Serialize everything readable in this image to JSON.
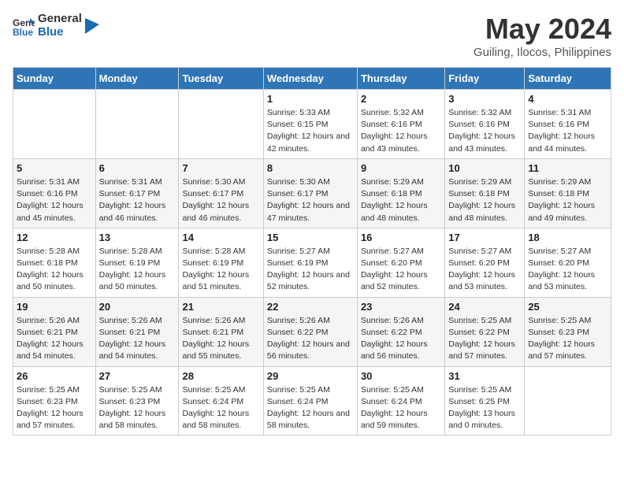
{
  "header": {
    "logo_line1": "General",
    "logo_line2": "Blue",
    "title": "May 2024",
    "subtitle": "Guiling, Ilocos, Philippines"
  },
  "days_of_week": [
    "Sunday",
    "Monday",
    "Tuesday",
    "Wednesday",
    "Thursday",
    "Friday",
    "Saturday"
  ],
  "weeks": [
    [
      {
        "day": "",
        "info": ""
      },
      {
        "day": "",
        "info": ""
      },
      {
        "day": "",
        "info": ""
      },
      {
        "day": "1",
        "sunrise": "Sunrise: 5:33 AM",
        "sunset": "Sunset: 6:15 PM",
        "daylight": "Daylight: 12 hours and 42 minutes."
      },
      {
        "day": "2",
        "sunrise": "Sunrise: 5:32 AM",
        "sunset": "Sunset: 6:16 PM",
        "daylight": "Daylight: 12 hours and 43 minutes."
      },
      {
        "day": "3",
        "sunrise": "Sunrise: 5:32 AM",
        "sunset": "Sunset: 6:16 PM",
        "daylight": "Daylight: 12 hours and 43 minutes."
      },
      {
        "day": "4",
        "sunrise": "Sunrise: 5:31 AM",
        "sunset": "Sunset: 6:16 PM",
        "daylight": "Daylight: 12 hours and 44 minutes."
      }
    ],
    [
      {
        "day": "5",
        "sunrise": "Sunrise: 5:31 AM",
        "sunset": "Sunset: 6:16 PM",
        "daylight": "Daylight: 12 hours and 45 minutes."
      },
      {
        "day": "6",
        "sunrise": "Sunrise: 5:31 AM",
        "sunset": "Sunset: 6:17 PM",
        "daylight": "Daylight: 12 hours and 46 minutes."
      },
      {
        "day": "7",
        "sunrise": "Sunrise: 5:30 AM",
        "sunset": "Sunset: 6:17 PM",
        "daylight": "Daylight: 12 hours and 46 minutes."
      },
      {
        "day": "8",
        "sunrise": "Sunrise: 5:30 AM",
        "sunset": "Sunset: 6:17 PM",
        "daylight": "Daylight: 12 hours and 47 minutes."
      },
      {
        "day": "9",
        "sunrise": "Sunrise: 5:29 AM",
        "sunset": "Sunset: 6:18 PM",
        "daylight": "Daylight: 12 hours and 48 minutes."
      },
      {
        "day": "10",
        "sunrise": "Sunrise: 5:29 AM",
        "sunset": "Sunset: 6:18 PM",
        "daylight": "Daylight: 12 hours and 48 minutes."
      },
      {
        "day": "11",
        "sunrise": "Sunrise: 5:29 AM",
        "sunset": "Sunset: 6:18 PM",
        "daylight": "Daylight: 12 hours and 49 minutes."
      }
    ],
    [
      {
        "day": "12",
        "sunrise": "Sunrise: 5:28 AM",
        "sunset": "Sunset: 6:18 PM",
        "daylight": "Daylight: 12 hours and 50 minutes."
      },
      {
        "day": "13",
        "sunrise": "Sunrise: 5:28 AM",
        "sunset": "Sunset: 6:19 PM",
        "daylight": "Daylight: 12 hours and 50 minutes."
      },
      {
        "day": "14",
        "sunrise": "Sunrise: 5:28 AM",
        "sunset": "Sunset: 6:19 PM",
        "daylight": "Daylight: 12 hours and 51 minutes."
      },
      {
        "day": "15",
        "sunrise": "Sunrise: 5:27 AM",
        "sunset": "Sunset: 6:19 PM",
        "daylight": "Daylight: 12 hours and 52 minutes."
      },
      {
        "day": "16",
        "sunrise": "Sunrise: 5:27 AM",
        "sunset": "Sunset: 6:20 PM",
        "daylight": "Daylight: 12 hours and 52 minutes."
      },
      {
        "day": "17",
        "sunrise": "Sunrise: 5:27 AM",
        "sunset": "Sunset: 6:20 PM",
        "daylight": "Daylight: 12 hours and 53 minutes."
      },
      {
        "day": "18",
        "sunrise": "Sunrise: 5:27 AM",
        "sunset": "Sunset: 6:20 PM",
        "daylight": "Daylight: 12 hours and 53 minutes."
      }
    ],
    [
      {
        "day": "19",
        "sunrise": "Sunrise: 5:26 AM",
        "sunset": "Sunset: 6:21 PM",
        "daylight": "Daylight: 12 hours and 54 minutes."
      },
      {
        "day": "20",
        "sunrise": "Sunrise: 5:26 AM",
        "sunset": "Sunset: 6:21 PM",
        "daylight": "Daylight: 12 hours and 54 minutes."
      },
      {
        "day": "21",
        "sunrise": "Sunrise: 5:26 AM",
        "sunset": "Sunset: 6:21 PM",
        "daylight": "Daylight: 12 hours and 55 minutes."
      },
      {
        "day": "22",
        "sunrise": "Sunrise: 5:26 AM",
        "sunset": "Sunset: 6:22 PM",
        "daylight": "Daylight: 12 hours and 56 minutes."
      },
      {
        "day": "23",
        "sunrise": "Sunrise: 5:26 AM",
        "sunset": "Sunset: 6:22 PM",
        "daylight": "Daylight: 12 hours and 56 minutes."
      },
      {
        "day": "24",
        "sunrise": "Sunrise: 5:25 AM",
        "sunset": "Sunset: 6:22 PM",
        "daylight": "Daylight: 12 hours and 57 minutes."
      },
      {
        "day": "25",
        "sunrise": "Sunrise: 5:25 AM",
        "sunset": "Sunset: 6:23 PM",
        "daylight": "Daylight: 12 hours and 57 minutes."
      }
    ],
    [
      {
        "day": "26",
        "sunrise": "Sunrise: 5:25 AM",
        "sunset": "Sunset: 6:23 PM",
        "daylight": "Daylight: 12 hours and 57 minutes."
      },
      {
        "day": "27",
        "sunrise": "Sunrise: 5:25 AM",
        "sunset": "Sunset: 6:23 PM",
        "daylight": "Daylight: 12 hours and 58 minutes."
      },
      {
        "day": "28",
        "sunrise": "Sunrise: 5:25 AM",
        "sunset": "Sunset: 6:24 PM",
        "daylight": "Daylight: 12 hours and 58 minutes."
      },
      {
        "day": "29",
        "sunrise": "Sunrise: 5:25 AM",
        "sunset": "Sunset: 6:24 PM",
        "daylight": "Daylight: 12 hours and 58 minutes."
      },
      {
        "day": "30",
        "sunrise": "Sunrise: 5:25 AM",
        "sunset": "Sunset: 6:24 PM",
        "daylight": "Daylight: 12 hours and 59 minutes."
      },
      {
        "day": "31",
        "sunrise": "Sunrise: 5:25 AM",
        "sunset": "Sunset: 6:25 PM",
        "daylight": "Daylight: 13 hours and 0 minutes."
      },
      {
        "day": "",
        "info": ""
      }
    ]
  ]
}
